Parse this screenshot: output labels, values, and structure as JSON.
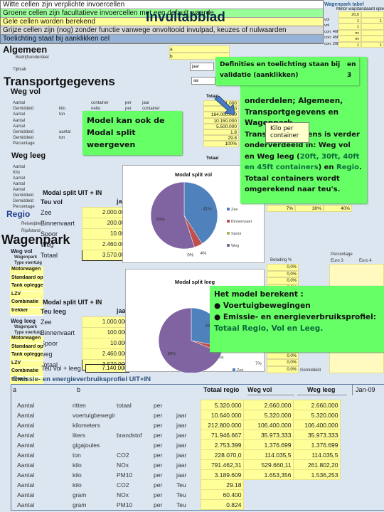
{
  "legend": {
    "white": "Witte cellen zijn verplichte  invoercellen",
    "green": "Groene cellen zijn facultatieve invoercellen met een default waarde",
    "yellow": "Gele cellen worden berekend",
    "gray": "Grijze cellen zijn (nog) zonder functie vanwege onvoltooid invulpad, keuzes of nulwaarden",
    "blue": "Toelichting staat bij aanklikken cel",
    "sheet_title": "Invultabblad",
    "colors": {
      "white": "#ffffff",
      "green": "#99ff99",
      "yellow": "#ffff99",
      "gray": "#d9d9d9",
      "blue": "#95b3d7"
    }
  },
  "algemeen": {
    "title": "Algemeen",
    "rows": [
      {
        "label": "Bedrijfsonderdeel",
        "value": "b"
      },
      {
        "label": "",
        "value": "a"
      }
    ],
    "tijdvak_label": "Tijdvak",
    "tijdvak_value": "jaar",
    "extra_value": "aa"
  },
  "wagenpark_tabel": {
    "title": "Wagenpark tabel",
    "headers": [
      "Motor wagen",
      "Standaard oplegger"
    ],
    "rows": [
      {
        "label": "",
        "v1": "20,0",
        "v2": ""
      },
      {
        "label": "vol",
        "v1": "1",
        "v2": "1"
      },
      {
        "label": "vol",
        "v1": "1",
        "v2": ""
      },
      {
        "label": "con: 40ft vol",
        "v1": "nv",
        "v2": ""
      },
      {
        "label": "con: 45ft vol",
        "v1": "nv",
        "v2": ""
      },
      {
        "label": "con: 20ft leeg",
        "v1": "1",
        "v2": "1"
      }
    ]
  },
  "transport": {
    "title": "Transportgegevens",
    "weg_vol": {
      "title": "Weg vol",
      "rows": [
        [
          "Aantal",
          "",
          "container",
          "per",
          "jaar"
        ],
        [
          "Gemiddeld",
          "kilo",
          "netto",
          "per",
          "container"
        ],
        [
          "Aantal",
          "ton",
          "",
          "",
          ""
        ],
        [
          "Aantal",
          "",
          "",
          "",
          ""
        ],
        [
          "Aantal",
          "",
          "",
          "",
          ""
        ],
        [
          "Gemiddeld",
          "aantal",
          "",
          "",
          ""
        ],
        [
          "Gemiddeld",
          "ton",
          "",
          "",
          ""
        ],
        [
          "Percentage",
          "",
          "",
          "",
          ""
        ]
      ],
      "totaal_label": "Totaal",
      "totaal_values": [
        "1.000",
        "10",
        "164.000.000",
        "10.150.000",
        "5.500.000",
        "1.8",
        "29.8",
        "100%"
      ]
    },
    "weg_leeg": {
      "title": "Weg leeg",
      "rows": [
        "Aantal",
        "Kilo",
        "Aantal",
        "Aantal",
        "Aantal",
        "Gemiddeld",
        "Gemiddeld",
        "Percentage"
      ],
      "totaal_label": "Totaal",
      "percent_values": [
        "7%",
        "30%",
        "40%"
      ]
    },
    "regio": {
      "title": "Regio",
      "rows": [
        "Reiswijdte",
        "Rijafstand"
      ]
    }
  },
  "modal_split_vol": {
    "title": "Modal split UIT + IN",
    "col1": "Teu vol",
    "col2": "jaar",
    "rows": [
      {
        "label": "Zee",
        "value": "2.000.000"
      },
      {
        "label": "Binnenvaart",
        "value": "200.000"
      },
      {
        "label": "Spoor",
        "value": "10.000"
      },
      {
        "label": "Weg",
        "value": "2.460.000"
      },
      {
        "label": "Totaal",
        "value": "3.570.000"
      }
    ]
  },
  "modal_split_leeg": {
    "title": "Modal split UIT + IN",
    "col1": "Teu leeg",
    "col2": "jaar",
    "rows": [
      {
        "label": "Zee",
        "value": "1.000.000"
      },
      {
        "label": "Binnenvaart",
        "value": "100.000"
      },
      {
        "label": "Spoor",
        "value": "10.000"
      },
      {
        "label": "weg",
        "value": "2.460.000"
      },
      {
        "label": "Totaal",
        "value": "3.570.000"
      }
    ],
    "sum_label": "Teu vol + leeg",
    "sum_value": "7.140.000"
  },
  "wagenpark": {
    "title": "Wagenpark",
    "vol_title": "Weg vol",
    "leeg_title": "Weg leeg",
    "sub1": "Wagenpark",
    "sub2": "Type voertuig",
    "types": [
      "Motorwagen",
      "Standaard oplegger",
      "Tank oplegger",
      "LZV",
      "Combinatie",
      "trekker"
    ],
    "belading_label": "Belading %",
    "belading_values": [
      "0,0%",
      "0,0%",
      "0,0%",
      "0,0%",
      "0,0%",
      "0,0%",
      "0,0%",
      "0,0%"
    ],
    "percentage_label": "Percentage",
    "euro3": "Euro 3",
    "euro4": "Euro 4",
    "gemiddeld": "Gemiddeld"
  },
  "chart_data": [
    {
      "type": "pie",
      "title": "Modal split vol",
      "categories": [
        "Zee",
        "Binnenvaart",
        "Spoor",
        "Weg"
      ],
      "values": [
        41,
        4,
        0,
        55
      ],
      "labels": [
        "41%",
        "4%",
        "0%",
        "55%"
      ],
      "colors": [
        "#4f81bd",
        "#c0504d",
        "#9bbb59",
        "#8064a2"
      ],
      "legend": "right"
    },
    {
      "type": "pie",
      "title": "Modal split leeg",
      "categories": [
        "Zee",
        "Binnenvaart",
        "Spoor",
        "Weg"
      ],
      "values": [
        28,
        3,
        0,
        69
      ],
      "labels": [
        "28%",
        "",
        "0%",
        "69%"
      ],
      "colors": [
        "#4f81bd",
        "#c0504d",
        "#9bbb59",
        "#8064a2"
      ],
      "legend": "right",
      "extra_label": "7%"
    }
  ],
  "callouts": {
    "c1": "Definities en toelichting staan bij validatie (aanklikken)",
    "c1_side": [
      "en",
      "3"
    ],
    "c2a": "onderdelen; Algemeen, Transportgegevens en Wagenpark.",
    "c2b": "Transportgegevens is verder onderverdeeld in: Weg vol en Weg leeg (",
    "c2c": "20ft, 30ft, 40ft en 45ft containers",
    "c2d": ") en ",
    "c2e": "Regio",
    "c2f": ". Totaal containers wordt omgerekend naar teu's.",
    "tooltip": "Kilo per container",
    "c3": "Model kan ook de Modal split weergeven",
    "c4_title": "Het model  berekent :",
    "c4_b1": "Voertuigbewegingen",
    "c4_b2": "Emissie- en energieverbruiksprofiel: ",
    "c4_b2g": "Totaal Regio, Vol en Leeg."
  },
  "emissie": {
    "title": "Emissie- en energieverbruiksprofiel UIT+IN",
    "headers": {
      "a": "a",
      "b": "b",
      "totaal": "Totaal regio",
      "vol": "Weg vol",
      "leeg": "Weg leeg",
      "date": "Jan-09"
    },
    "rows": [
      [
        "Aantal",
        "ritten",
        "totaal",
        "per",
        "",
        "5.320.000",
        "2.660.000",
        "2.660.000"
      ],
      [
        "Aantal",
        "voertuigbewegingen",
        "",
        "per",
        "jaar",
        "10.640.000",
        "5.320.000",
        "5.320.000"
      ],
      [
        "Aantal",
        "kilometers",
        "",
        "per",
        "jaar",
        "212.800.000",
        "106.400.000",
        "106.400.000"
      ],
      [
        "Aantal",
        "liters",
        "brandstof",
        "per",
        "jaar",
        "71.946.667",
        "35.973.333",
        "35.973.333"
      ],
      [
        "Aantal",
        "gigajoules",
        "",
        "per",
        "jaar",
        "2.753.399",
        "1.376.699",
        "1.376.699"
      ],
      [
        "Aantal",
        "ton",
        "CO2",
        "per",
        "jaar",
        "228.070,0",
        "114.035,5",
        "114.035,5"
      ],
      [
        "Aantal",
        "kilo",
        "NOx",
        "per",
        "jaar",
        "791.462,31",
        "529.660,11",
        "261.802,20"
      ],
      [
        "Aantal",
        "kilo",
        "PM10",
        "per",
        "jaar",
        "3.189.609",
        "1.653,356",
        "1.536,253"
      ],
      [
        "Aantal",
        "kilo",
        "CO2",
        "per",
        "Teu",
        "29.18",
        "",
        ""
      ],
      [
        "Aantal",
        "gram",
        "NOx",
        "per",
        "Teu",
        "60.400",
        "",
        ""
      ],
      [
        "Aantal",
        "gram",
        "PM10",
        "per",
        "Teu",
        "0.824",
        "",
        ""
      ]
    ]
  }
}
